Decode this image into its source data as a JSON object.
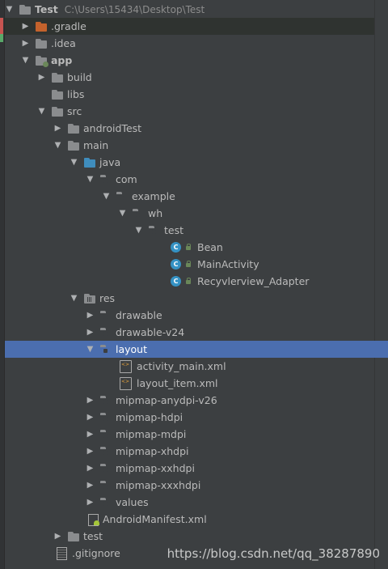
{
  "root": {
    "name": "Test",
    "path": "C:\\Users\\15434\\Desktop\\Test"
  },
  "nodes": {
    "gradle": ".gradle",
    "idea": ".idea",
    "app": "app",
    "build": "build",
    "libs": "libs",
    "src": "src",
    "androidTest": "androidTest",
    "main": "main",
    "java": "java",
    "com": "com",
    "example": "example",
    "wh": "wh",
    "test_pkg": "test",
    "bean": "Bean",
    "main_activity": "MainActivity",
    "adapter": "Recyvlerview_Adapter",
    "res": "res",
    "drawable": "drawable",
    "drawable_v24": "drawable-v24",
    "layout": "layout",
    "activity_main": "activity_main.xml",
    "layout_item": "layout_item.xml",
    "mipmap_anydpi": "mipmap-anydpi-v26",
    "mipmap_hdpi": "mipmap-hdpi",
    "mipmap_mdpi": "mipmap-mdpi",
    "mipmap_xhdpi": "mipmap-xhdpi",
    "mipmap_xxhdpi": "mipmap-xxhdpi",
    "mipmap_xxxhdpi": "mipmap-xxxhdpi",
    "values": "values",
    "manifest": "AndroidManifest.xml",
    "test_dir": "test",
    "gitignore": ".gitignore"
  },
  "class_badge": "C",
  "watermark": "https://blog.csdn.net/qq_38287890",
  "colors": {
    "background": "#3c3f41",
    "selection": "#4b6eaf",
    "text": "#bbbbbb",
    "excluded_folder": "#c4622c",
    "source_folder": "#3f8dbd",
    "class_icon": "#3592c4"
  }
}
